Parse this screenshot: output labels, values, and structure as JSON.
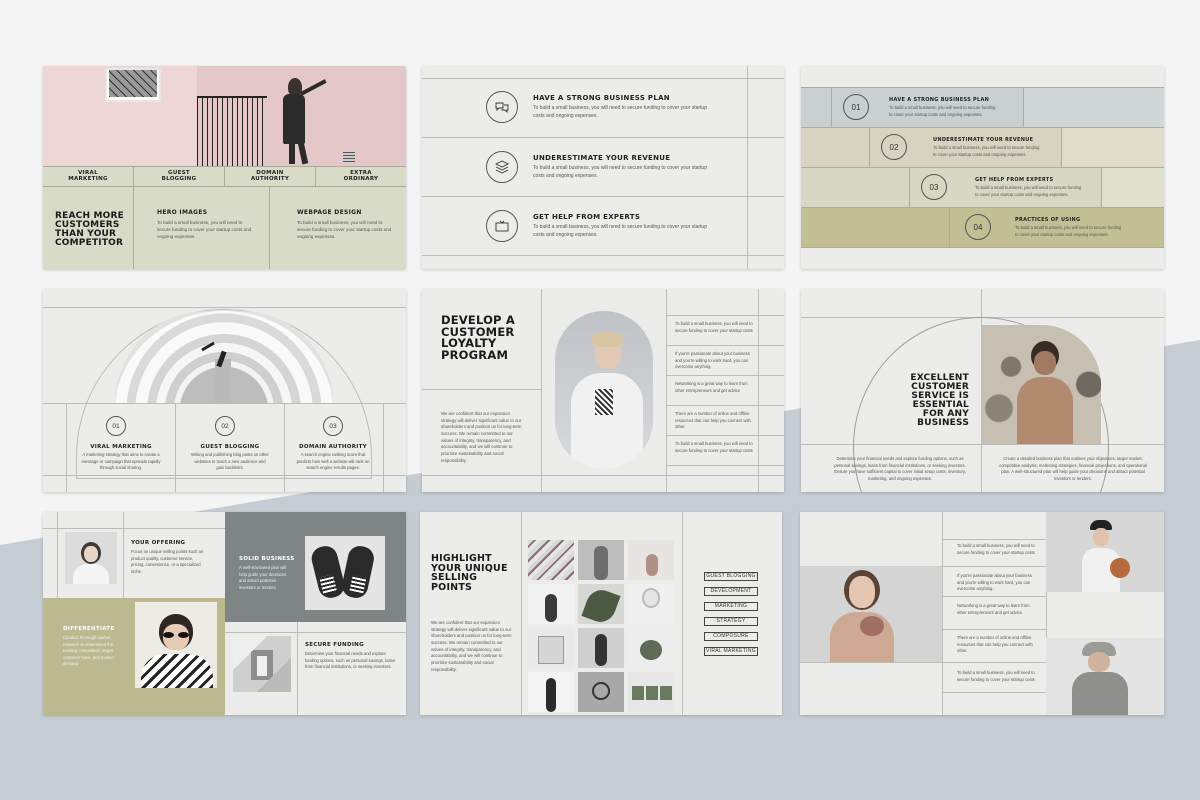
{
  "colors": {
    "page_bg": "#f4f4f4",
    "bottom_band": "#c5ccd3",
    "slide_bg": "#ececea",
    "sage": "#d9dbc9",
    "olive": "#bcb991",
    "slate": "#7f8485"
  },
  "slide1": {
    "tabs": [
      "VIRAL MARKETING",
      "GUEST BLOGGING",
      "DOMAIN AUTHORITY",
      "EXTRA ORDINARY"
    ],
    "title": "REACH MORE CUSTOMERS THAN YOUR COMPETITOR",
    "col1_head": "HERO IMAGES",
    "col1_body": "To build a small business, you will need to secure funding to cover your startup costs and ongoing expenses.",
    "col2_head": "WEBPAGE DESIGN",
    "col2_body": "To build a small business, you will need to secure funding to cover your startup costs and ongoing expenses."
  },
  "slide2": {
    "rows": [
      {
        "icon": "chat-bubbles-icon",
        "head": "HAVE A STRONG BUSINESS PLAN",
        "body": "To build a small business, you will need to secure funding to cover your startup costs and ongoing expenses."
      },
      {
        "icon": "layers-icon",
        "head": "UNDERESTIMATE YOUR REVENUE",
        "body": "To build a small business, you will need to secure funding to cover your startup costs and ongoing expenses."
      },
      {
        "icon": "tv-icon",
        "head": "GET HELP FROM EXPERTS",
        "body": "To build a small business, you will need to secure funding to cover your startup costs and ongoing expenses."
      }
    ]
  },
  "slide3": {
    "steps": [
      {
        "num": "01",
        "head": "HAVE A STRONG BUSINESS PLAN",
        "body": "To build a small business, you will need to secure funding to cover your startup costs and ongoing expenses.",
        "color": "#c9d0cf"
      },
      {
        "num": "02",
        "head": "UNDERESTIMATE YOUR REVENUE",
        "body": "To build a small business, you will need to secure funding to cover your startup costs and ongoing expenses.",
        "color": "#d8d2c0"
      },
      {
        "num": "03",
        "head": "GET HELP FROM EXPERTS",
        "body": "To build a small business, you will need to secure funding to cover your startup costs and ongoing expenses.",
        "color": "#d6d8c3"
      },
      {
        "num": "04",
        "head": "PRACTICES OF USING",
        "body": "To build a small business, you will need to secure funding to cover your startup costs and ongoing expenses.",
        "color": "#c2bf95"
      }
    ]
  },
  "slide4": {
    "cols": [
      {
        "num": "01",
        "head": "VIRAL MARKETING",
        "body": "A marketing strategy that aims to create a message or campaign that spreads rapidly through social sharing."
      },
      {
        "num": "02",
        "head": "GUEST BLOGGING",
        "body": "Writing and publishing blog posts on other websites to reach a new audience and gain backlinks."
      },
      {
        "num": "03",
        "head": "DOMAIN AUTHORITY",
        "body": "A search engine ranking score that predicts how well a website will rank on search engine results pages."
      }
    ]
  },
  "slide5": {
    "title": "DEVELOP A CUSTOMER LOYALTY PROGRAM",
    "body": "We are confident that our expansion strategy will deliver significant value to our shareholders and position us for long-term success. We remain committed to our values of integrity, transparency, and accountability, and we will continue to prioritize sustainability and social responsibility.",
    "list": [
      "To build a small business, you will need to secure funding to cover your startup costs",
      "If you're passionate about your business and you're willing to work hard, you can overcome anything.",
      "Networking is a great way to learn from other entrepreneurs and get advice",
      "There are a number of online and offline resources that can help you connect with other.",
      "To build a small business, you will need to secure funding to cover your startup costs"
    ]
  },
  "slide6": {
    "title": "EXCELLENT CUSTOMER SERVICE IS ESSENTIAL FOR ANY BUSINESS",
    "left_body": "Determine your financial needs and explore funding options, such as personal savings, loans from financial institutions, or seeking investors. Ensure you have sufficient capital to cover initial setup costs, inventory, marketing, and ongoing expenses.",
    "right_body": "Create a detailed business plan that outlines your objectives, target market, competitive analysis, marketing strategies, financial projections, and operational plan. A well-structured plan will help guide your decisions and attract potential investors or lenders."
  },
  "slide7": {
    "blocks": [
      {
        "head": "YOUR OFFERING",
        "body": "Focus on unique selling points such as product quality, customer service, pricing, convenience, or a specialized niche."
      },
      {
        "head": "SOLID BUSINESS",
        "body": "A well-structured plan will help guide your decisions and attract potential investors or lenders."
      },
      {
        "head": "DIFFERENTIATE",
        "body": "Conduct thorough market research to understand the existing competition, target customer base, and market demand."
      },
      {
        "head": "SECURE FUNDING",
        "body": "Determine your financial needs and explore funding options, such as personal savings, loans from financial institutions, or seeking investors."
      }
    ]
  },
  "slide8": {
    "title": "HIGHLIGHT YOUR UNIQUE SELLING POINTS",
    "body": "We are confident that our expansion strategy will deliver significant value to our shareholders and position us for long-term success. We remain committed to our values of integrity, transparency, and accountability, and we will continue to prioritize sustainability and social responsibility.",
    "tags": [
      "GUEST BLOGGING",
      "DEVELOPMENT",
      "MARKETING",
      "STRATEGY",
      "COMPOSURE",
      "VIRAL MARKETING"
    ]
  },
  "slide9": {
    "list": [
      "To build a small business, you will need to secure funding to cover your startup costs",
      "If you're passionate about your business and you're willing to work hard, you can overcome anything.",
      "Networking is a great way to learn from other entrepreneurs and get advice",
      "There are a number of online and offline resources that can help you connect with other.",
      "To build a small business, you will need to secure funding to cover your startup costs"
    ]
  }
}
